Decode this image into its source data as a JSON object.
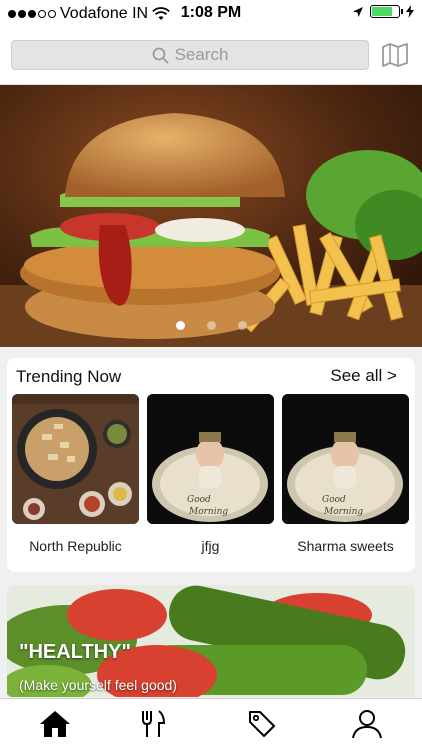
{
  "status_bar": {
    "carrier": "Vodafone IN",
    "time": "1:08 PM",
    "icons": [
      "signal-dots-icon",
      "wifi-icon",
      "location-arrow-icon",
      "battery-icon",
      "charging-bolt-icon"
    ]
  },
  "search": {
    "placeholder": "Search",
    "icon": "search-icon",
    "map_icon": "map-icon"
  },
  "banner": {
    "slide_count": 3,
    "active_slide": 1
  },
  "trending": {
    "title": "Trending Now",
    "see_all": "See all >",
    "items": [
      {
        "name": "North Republic"
      },
      {
        "name": "jfjg"
      },
      {
        "name": "Sharma sweets"
      }
    ]
  },
  "healthy": {
    "title": "\"HEALTHY\"",
    "subtitle": "(Make yourself feel good)"
  },
  "tabbar": {
    "tabs": [
      {
        "icon": "home-icon",
        "active": true
      },
      {
        "icon": "fork-knife-icon",
        "active": false
      },
      {
        "icon": "tag-icon",
        "active": false
      },
      {
        "icon": "profile-icon",
        "active": false
      }
    ]
  }
}
